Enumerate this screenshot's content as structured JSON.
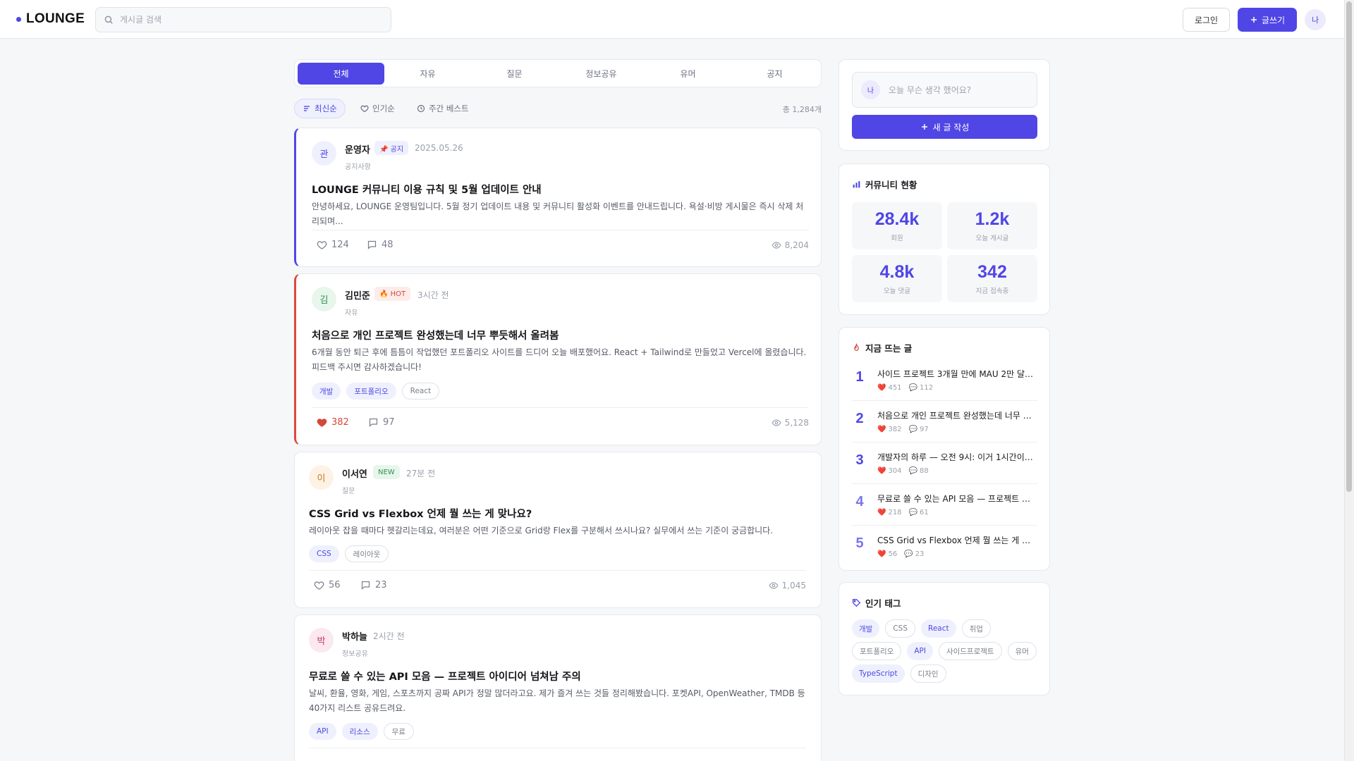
{
  "header": {
    "logo": "LOUNGE",
    "search_placeholder": "게시글 검색",
    "login_label": "로그인",
    "write_label": "글쓰기",
    "avatar_initial": "나",
    "accent": "#4f46e5"
  },
  "tabs": [
    {
      "label": "전체",
      "active": true
    },
    {
      "label": "자유",
      "active": false
    },
    {
      "label": "질문",
      "active": false
    },
    {
      "label": "정보공유",
      "active": false
    },
    {
      "label": "유머",
      "active": false
    },
    {
      "label": "공지",
      "active": false
    }
  ],
  "sort": {
    "options": [
      "최신순",
      "인기순",
      "주간 베스트"
    ],
    "active": "최신순",
    "total": "총 1,284개"
  },
  "posts": [
    {
      "avatar": "관",
      "author": "운영자",
      "badge": "📌 공지",
      "badge_type": "notice",
      "time": "2025.05.26",
      "category": "공지사항",
      "title": "LOUNGE 커뮤니티 이용 규칙 및 5월 업데이트 안내",
      "body": "안녕하세요, LOUNGE 운영팀입니다. 5월 정기 업데이트 내용 및 커뮤니티 활성화 이벤트를 안내드립니다. 욕설·비방 게시물은 즉시 삭제 처리되며...",
      "tags": [],
      "likes": "124",
      "comments": "48",
      "views": "8,204",
      "liked": false
    },
    {
      "avatar": "김",
      "author": "김민준",
      "badge": "🔥 HOT",
      "badge_type": "hot",
      "time": "3시간 전",
      "category": "자유",
      "title": "처음으로 개인 프로젝트 완성했는데 너무 뿌듯해서 올려봄",
      "body": "6개월 동안 퇴근 후에 틈틈이 작업했던 포트폴리오 사이트를 드디어 오늘 배포했어요. React + Tailwind로 만들었고 Vercel에 올렸습니다. 피드백 주시면 감사하겠습니다!",
      "tags": [
        "개발",
        "포트폴리오",
        "React"
      ],
      "likes": "382",
      "comments": "97",
      "views": "5,128",
      "liked": true
    },
    {
      "avatar": "이",
      "author": "이서연",
      "badge": "NEW",
      "badge_type": "new",
      "time": "27분 전",
      "category": "질문",
      "title": "CSS Grid vs Flexbox 언제 뭘 쓰는 게 맞나요?",
      "body": "레이아웃 잡을 때마다 헷갈리는데요, 여러분은 어떤 기준으로 Grid랑 Flex를 구분해서 쓰시나요? 실무에서 쓰는 기준이 궁금합니다.",
      "tags": [
        "CSS",
        "레이아웃"
      ],
      "likes": "56",
      "comments": "23",
      "views": "1,045",
      "liked": false
    },
    {
      "avatar": "박",
      "author": "박하늘",
      "badge": "",
      "badge_type": "",
      "time": "2시간 전",
      "category": "정보공유",
      "title": "무료로 쓸 수 있는 API 모음 — 프로젝트 아이디어 넘쳐남 주의",
      "body": "날씨, 환율, 영화, 게임, 스포츠까지 공짜 API가 정말 많더라고요. 제가 즐겨 쓰는 것들 정리해봤습니다. 포켓API, OpenWeather, TMDB 등 40가지 리스트 공유드려요.",
      "tags": [
        "API",
        "리소스",
        "무료"
      ],
      "likes": "",
      "comments": "",
      "views": "",
      "liked": false
    }
  ],
  "sidebar": {
    "compose": {
      "avatar": "나",
      "placeholder": "오늘 무슨 생각 했어요?",
      "button": "새 글 작성"
    },
    "stats": {
      "title": "커뮤니티 현황",
      "items": [
        {
          "value": "28.4k",
          "label": "회원"
        },
        {
          "value": "1.2k",
          "label": "오늘 게시글"
        },
        {
          "value": "4.8k",
          "label": "오늘 댓글"
        },
        {
          "value": "342",
          "label": "지금 접속중"
        }
      ]
    },
    "trending": {
      "title": "지금 뜨는 글",
      "items": [
        {
          "rank": "1",
          "title": "사이드 프로젝트 3개월 만에 MAU 2만 달성...",
          "likes": "451",
          "comments": "112"
        },
        {
          "rank": "2",
          "title": "처음으로 개인 프로젝트 완성했는데 너무 뿌...",
          "likes": "382",
          "comments": "97"
        },
        {
          "rank": "3",
          "title": "개발자의 하루 — 오전 9시: 이거 1시간이면...",
          "likes": "304",
          "comments": "88"
        },
        {
          "rank": "4",
          "title": "무료로 쓸 수 있는 API 모음 — 프로젝트 아...",
          "likes": "218",
          "comments": "61"
        },
        {
          "rank": "5",
          "title": "CSS Grid vs Flexbox 언제 뭘 쓰는 게 맞...",
          "likes": "56",
          "comments": "23"
        }
      ]
    },
    "tags": {
      "title": "인기 태그",
      "items": [
        {
          "label": "개발",
          "highlight": true
        },
        {
          "label": "CSS",
          "highlight": false
        },
        {
          "label": "React",
          "highlight": true
        },
        {
          "label": "취업",
          "highlight": false
        },
        {
          "label": "포트폴리오",
          "highlight": false
        },
        {
          "label": "API",
          "highlight": true
        },
        {
          "label": "사이드프로젝트",
          "highlight": false
        },
        {
          "label": "유머",
          "highlight": false
        },
        {
          "label": "TypeScript",
          "highlight": true
        },
        {
          "label": "디자인",
          "highlight": false
        }
      ]
    }
  }
}
